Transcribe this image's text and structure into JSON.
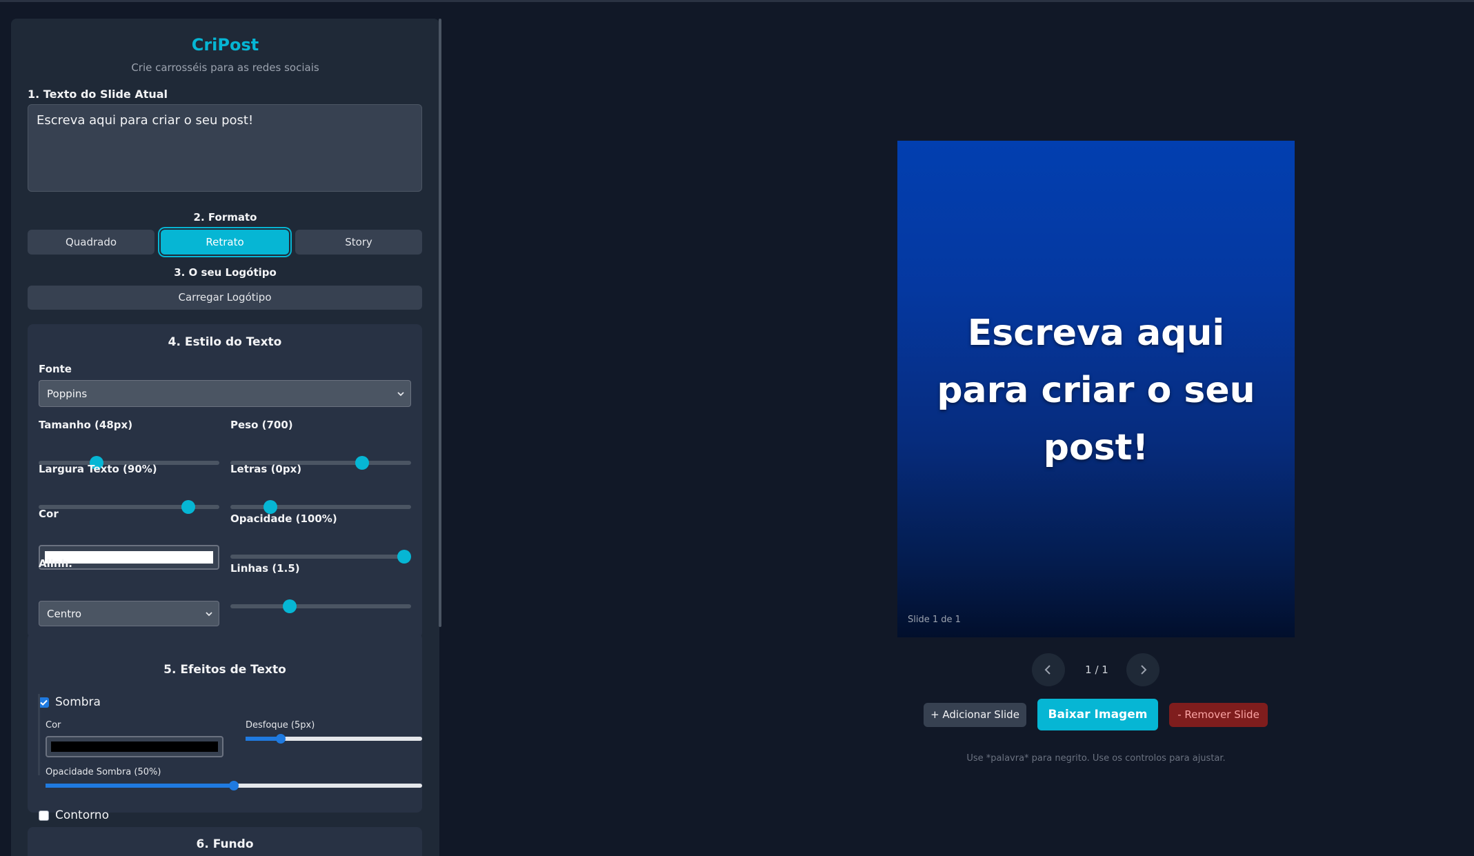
{
  "app": {
    "title": "CriPost",
    "subtitle": "Crie carrosséis para as redes sociais"
  },
  "slide_text": {
    "label": "1. Texto do Slide Atual",
    "value": "Escreva aqui para criar o seu post!"
  },
  "format": {
    "label": "2. Formato",
    "options": [
      "Quadrado",
      "Retrato",
      "Story"
    ],
    "selected": "Retrato"
  },
  "logo": {
    "label": "3. O seu Logótipo",
    "button": "Carregar Logótipo"
  },
  "text_style": {
    "title": "4. Estilo do Texto",
    "font_label": "Fonte",
    "font_value": "Poppins",
    "size_label": "Tamanho (48px)",
    "size_fraction": 0.32,
    "weight_label": "Peso (700)",
    "weight_fraction": 0.73,
    "width_label": "Largura Texto (90%)",
    "width_fraction": 0.83,
    "letters_label": "Letras (0px)",
    "letters_fraction": 0.22,
    "color_label": "Cor",
    "color_value": "#ffffff",
    "opacity_label": "Opacidade (100%)",
    "opacity_fraction": 0.96,
    "align_label": "Alinh.",
    "align_value": "Centro",
    "lines_label": "Linhas (1.5)",
    "lines_fraction": 0.33
  },
  "text_effects": {
    "title": "5. Efeitos de Texto",
    "shadow_label": "Sombra",
    "shadow_checked": true,
    "shadow_color_label": "Cor",
    "shadow_color_value": "#000000",
    "blur_label": "Desfoque (5px)",
    "blur_fraction": 0.2,
    "shadow_opacity_label": "Opacidade Sombra (50%)",
    "shadow_opacity_fraction": 0.5,
    "outline_label": "Contorno",
    "outline_checked": false
  },
  "background": {
    "title": "6. Fundo"
  },
  "preview": {
    "text": "Escreva aqui para criar o seu post!",
    "slide_counter": "Slide 1 de 1",
    "page_indicator": "1 / 1"
  },
  "actions": {
    "add_slide": "+ Adicionar Slide",
    "download": "Baixar Imagem",
    "remove_slide": "- Remover Slide"
  },
  "hint": "Use *palavra* para negrito. Use os controlos para ajustar.",
  "colors": {
    "accent": "#06b6d4",
    "panel": "#1f2937",
    "background": "#111827",
    "danger": "#7f1d1d"
  }
}
